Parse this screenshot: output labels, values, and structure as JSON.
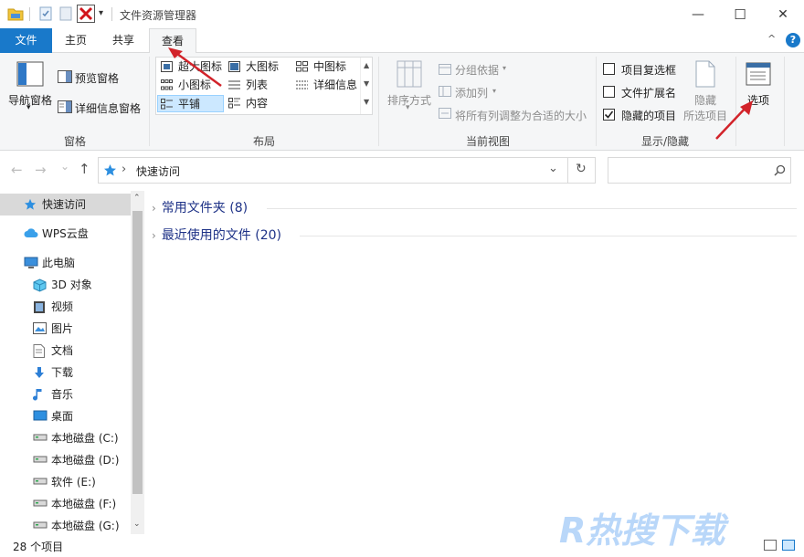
{
  "window": {
    "title": "文件资源管理器",
    "qat_dropdown_glyph": "▾",
    "minimize_glyph": "—",
    "maximize_glyph": "☐",
    "close_glyph": "✕"
  },
  "ribbon_tabs": {
    "file": "文件",
    "home": "主页",
    "share": "共享",
    "view": "查看",
    "collapse_glyph": "^",
    "help_glyph": "?"
  },
  "panes": {
    "nav_pane": "导航窗格",
    "preview_pane": "预览窗格",
    "details_pane": "详细信息窗格",
    "group": "窗格"
  },
  "layout": {
    "items": {
      "extra_large": "超大图标",
      "large": "大图标",
      "medium": "中图标",
      "small": "小图标",
      "list": "列表",
      "details": "详细信息",
      "tiles": "平铺",
      "content": "内容"
    },
    "selected": "平铺",
    "group": "布局"
  },
  "current_view": {
    "sort_by": "排序方式",
    "group_by": "分组依据",
    "add_column": "添加列",
    "size_all_columns": "将所有列调整为合适的大小",
    "group": "当前视图"
  },
  "show_hide": {
    "item_checkboxes": {
      "label": "项目复选框",
      "checked": false
    },
    "file_extensions": {
      "label": "文件扩展名",
      "checked": false
    },
    "hidden_items": {
      "label": "隐藏的项目",
      "checked": true
    },
    "hide_selected": "隐藏",
    "hide_selected_2": "所选项目",
    "group": "显示/隐藏"
  },
  "options": {
    "label": "选项"
  },
  "address": {
    "path": "快速访问",
    "separator": "›",
    "back_glyph": "←",
    "forward_glyph": "→",
    "recent_glyph": "⌄",
    "up_glyph": "↑",
    "dropdown_glyph": "⌄",
    "refresh_glyph": "↻",
    "search_placeholder": ""
  },
  "nav_pane": {
    "items": [
      {
        "label": "快速访问",
        "icon": "star-icon",
        "selected": true
      },
      {
        "label": "WPS云盘",
        "icon": "cloud-icon"
      },
      {
        "label": "此电脑",
        "icon": "pc-icon"
      },
      {
        "label": "3D 对象",
        "icon": "cube-icon"
      },
      {
        "label": "视频",
        "icon": "video-icon"
      },
      {
        "label": "图片",
        "icon": "picture-icon"
      },
      {
        "label": "文档",
        "icon": "document-icon"
      },
      {
        "label": "下载",
        "icon": "download-icon"
      },
      {
        "label": "音乐",
        "icon": "music-icon"
      },
      {
        "label": "桌面",
        "icon": "desktop-icon"
      },
      {
        "label": "本地磁盘 (C:)",
        "icon": "drive-icon"
      },
      {
        "label": "本地磁盘 (D:)",
        "icon": "drive-icon"
      },
      {
        "label": "软件 (E:)",
        "icon": "drive-icon"
      },
      {
        "label": "本地磁盘 (F:)",
        "icon": "drive-icon"
      },
      {
        "label": "本地磁盘 (G:)",
        "icon": "drive-icon"
      }
    ]
  },
  "content": {
    "groups": [
      {
        "label": "常用文件夹 (8)"
      },
      {
        "label": "最近使用的文件 (20)"
      }
    ]
  },
  "status_bar": {
    "item_count": "28 个项目"
  },
  "watermark": {
    "text": "R热搜下载"
  },
  "colors": {
    "accent": "#1979ca",
    "group_header": "#1e3287",
    "annotation_arrow": "#d2232a",
    "selection": "#cce8ff"
  }
}
